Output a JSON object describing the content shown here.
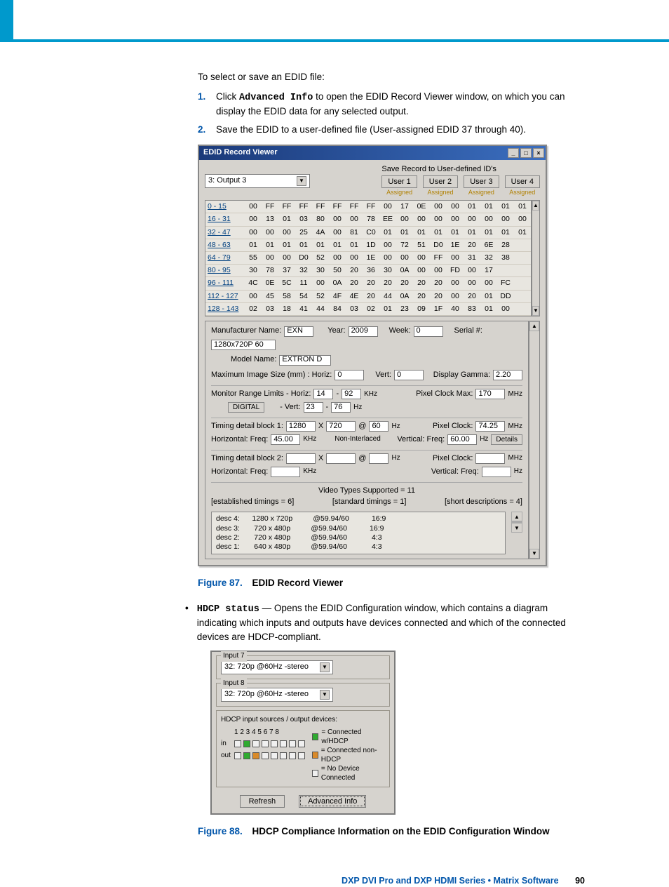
{
  "intro": "To select or save an EDID file:",
  "steps": [
    {
      "n": "1.",
      "pre": "Click ",
      "code": "Advanced Info",
      "post": " to open the EDID Record Viewer window, on which you can display the EDID data for any selected output."
    },
    {
      "n": "2.",
      "pre": "Save the EDID to a user-defined file (User-assigned EDID 37 through 40).",
      "code": "",
      "post": ""
    }
  ],
  "win1": {
    "title": "EDID Record Viewer",
    "saveLabel": "Save Record to User-defined ID's",
    "userBtns": [
      "User 1",
      "User 2",
      "User 3",
      "User 4"
    ],
    "assigned": "Assigned",
    "outputSel": "3: Output 3",
    "hexRows": [
      {
        "r": "0 - 15",
        "c": [
          "00",
          "FF",
          "FF",
          "FF",
          "FF",
          "FF",
          "FF",
          "FF",
          "00",
          "17",
          "0E",
          "00",
          "00",
          "01",
          "01",
          "01",
          "01"
        ]
      },
      {
        "r": "16 - 31",
        "c": [
          "00",
          "13",
          "01",
          "03",
          "80",
          "00",
          "00",
          "78",
          "EE",
          "00",
          "00",
          "00",
          "00",
          "00",
          "00",
          "00",
          "00"
        ]
      },
      {
        "r": "32 - 47",
        "c": [
          "00",
          "00",
          "00",
          "25",
          "4A",
          "00",
          "81",
          "C0",
          "01",
          "01",
          "01",
          "01",
          "01",
          "01",
          "01",
          "01",
          "01"
        ]
      },
      {
        "r": "48 - 63",
        "c": [
          "01",
          "01",
          "01",
          "01",
          "01",
          "01",
          "01",
          "1D",
          "00",
          "72",
          "51",
          "D0",
          "1E",
          "20",
          "6E",
          "28",
          ""
        ]
      },
      {
        "r": "64 - 79",
        "c": [
          "55",
          "00",
          "00",
          "D0",
          "52",
          "00",
          "00",
          "1E",
          "00",
          "00",
          "00",
          "FF",
          "00",
          "31",
          "32",
          "38",
          ""
        ]
      },
      {
        "r": "80 - 95",
        "c": [
          "30",
          "78",
          "37",
          "32",
          "30",
          "50",
          "20",
          "36",
          "30",
          "0A",
          "00",
          "00",
          "FD",
          "00",
          "17",
          "",
          ""
        ]
      },
      {
        "r": "96 - 111",
        "c": [
          "4C",
          "0E",
          "5C",
          "11",
          "00",
          "0A",
          "20",
          "20",
          "20",
          "20",
          "20",
          "20",
          "00",
          "00",
          "00",
          "FC",
          ""
        ]
      },
      {
        "r": "112 - 127",
        "c": [
          "00",
          "45",
          "58",
          "54",
          "52",
          "4F",
          "4E",
          "20",
          "44",
          "0A",
          "20",
          "20",
          "00",
          "20",
          "01",
          "DD",
          ""
        ]
      },
      {
        "r": "128 - 143",
        "c": [
          "02",
          "03",
          "18",
          "41",
          "44",
          "84",
          "03",
          "02",
          "01",
          "23",
          "09",
          "1F",
          "40",
          "83",
          "01",
          "00",
          ""
        ]
      }
    ],
    "fields": {
      "mfrNameLbl": "Manufacturer Name:",
      "mfrName": "EXN",
      "yearLbl": "Year:",
      "year": "2009",
      "weekLbl": "Week:",
      "week": "0",
      "serialLbl": "Serial #:",
      "serial": "1280x720P 60",
      "modelNameLbl": "Model Name:",
      "modelName": "EXTRON D",
      "maxImgLbl": "Maximum Image Size (mm) :  Horiz:",
      "maxH": "0",
      "vertLbl": "Vert:",
      "maxV": "0",
      "gammaLbl": "Display Gamma:",
      "gamma": "2.20",
      "rangeLbl": "Monitor Range Limits - Horiz:",
      "rhA": "14",
      "rhB": "92",
      "khz": "KHz",
      "digital": "DIGITAL",
      "vertRange": "- Vert:",
      "rvA": "23",
      "rvB": "76",
      "hz": "Hz",
      "pclkMaxLbl": "Pixel Clock Max:",
      "pclkMax": "170",
      "mhz": "MHz",
      "tb1Lbl": "Timing detail block 1:",
      "tb1w": "1280",
      "x": "X",
      "tb1h": "720",
      "at": "@",
      "tb1r": "60",
      "pclkLbl": "Pixel Clock:",
      "tb1pclk": "74.25",
      "hfreqLbl": "Horizontal:   Freq:",
      "tb1hf": "45.00",
      "nonInt": "Non-Interlaced",
      "vfreqLbl": "Vertical:   Freq:",
      "tb1vf": "60.00",
      "details": "Details",
      "tb2Lbl": "Timing detail block 2:",
      "videoTypes": "Video Types Supported = 11",
      "estT": "[established timings = 6]",
      "stdT": "[standard timings = 1]",
      "shortD": "[short descriptions = 4]",
      "descBlock": "desc 4:      1280 x 720p          @59.94/60           16:9\ndesc 3:       720 x 480p          @59.94/60           16:9\ndesc 2:       720 x 480p          @59.94/60            4:3\ndesc 1:       640 x 480p          @59.94/60            4:3"
    }
  },
  "fig87": {
    "num": "Figure 87.",
    "title": "EDID Record Viewer"
  },
  "bullet": {
    "code": "HDCP status",
    "text": " — Opens the EDID Configuration window, which contains a diagram indicating which inputs and outputs have devices connected and which of the connected devices are HDCP-compliant."
  },
  "win2": {
    "in7": "Input 7",
    "in8": "Input 8",
    "sel": "32: 720p @60Hz -stereo",
    "hdr": "HDCP input sources / output devices:",
    "cols": "1   2   3   4   5   6   7   8",
    "inLbl": "in",
    "outLbl": "out",
    "leg1": "= Connected w/HDCP",
    "leg2": "= Connected non-HDCP",
    "leg3": "= No Device Connected",
    "refresh": "Refresh",
    "adv": "Advanced Info"
  },
  "fig88": {
    "num": "Figure 88.",
    "title": "HDCP Compliance Information on the EDID Configuration Window"
  },
  "footer": {
    "text": "DXP DVI Pro and DXP HDMI Series • Matrix Software",
    "page": "90"
  }
}
